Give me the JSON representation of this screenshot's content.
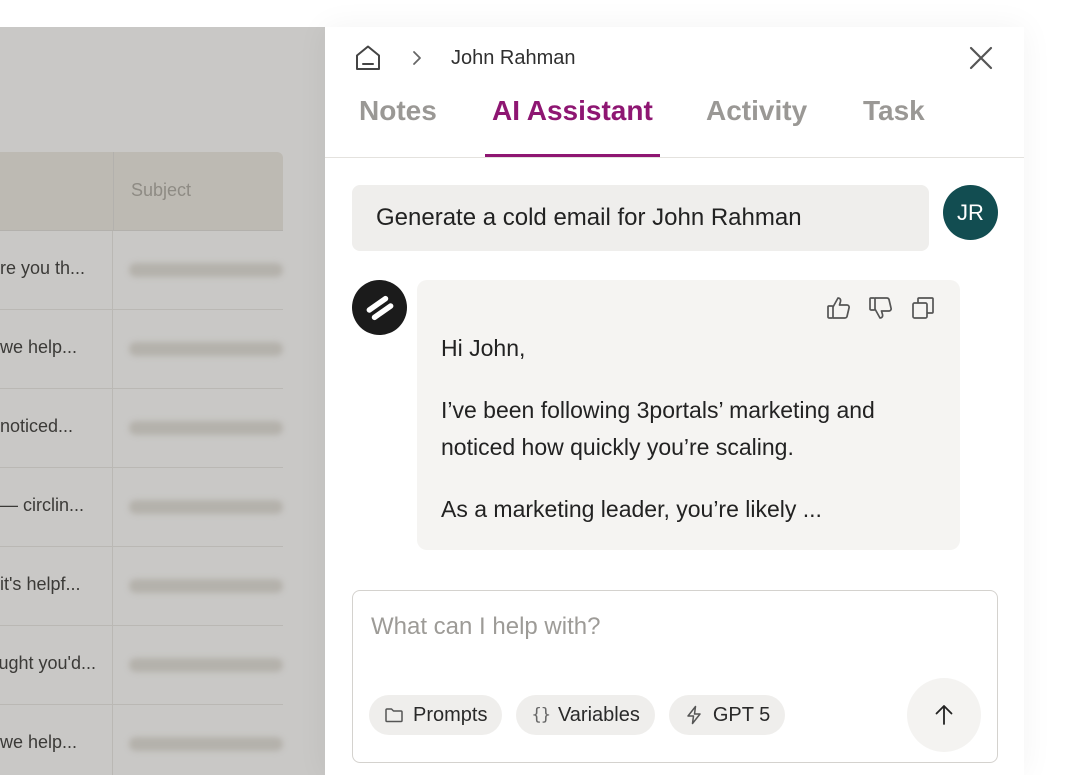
{
  "background_table": {
    "header_subject": "Subject",
    "rows": [
      {
        "preview": "re you th..."
      },
      {
        "preview": "we help..."
      },
      {
        "preview": "noticed..."
      },
      {
        "preview": "— circlin..."
      },
      {
        "preview": "it's helpf..."
      },
      {
        "preview": "ught you'd..."
      },
      {
        "preview": "we help..."
      }
    ]
  },
  "panel": {
    "breadcrumb": {
      "home_icon": "home-icon",
      "current": "John Rahman"
    },
    "close_icon": "close-icon",
    "tabs": [
      {
        "label": "Notes",
        "active": false
      },
      {
        "label": "AI Assistant",
        "active": true
      },
      {
        "label": "Activity",
        "active": false
      },
      {
        "label": "Task",
        "active": false
      }
    ],
    "accent_color": "#8e1672",
    "user_message": "Generate a cold email for John Rahman",
    "user_avatar": {
      "initials": "JR",
      "color": "#124d51"
    },
    "assistant_message": {
      "paragraphs": [
        "Hi John,",
        "I’ve been following 3portals’ marketing and noticed how quickly you’re scaling.",
        "As a marketing leader, you’re likely ..."
      ],
      "actions": [
        "thumbs-up-icon",
        "thumbs-down-icon",
        "copy-icon"
      ]
    },
    "composer": {
      "placeholder": "What can I help with?",
      "value": "",
      "chips": [
        {
          "label": "Prompts",
          "icon": "folder-icon"
        },
        {
          "label": "Variables",
          "icon": "braces-icon"
        },
        {
          "label": "GPT 5",
          "icon": "lightning-icon"
        }
      ],
      "send_icon": "arrow-up-icon"
    }
  }
}
